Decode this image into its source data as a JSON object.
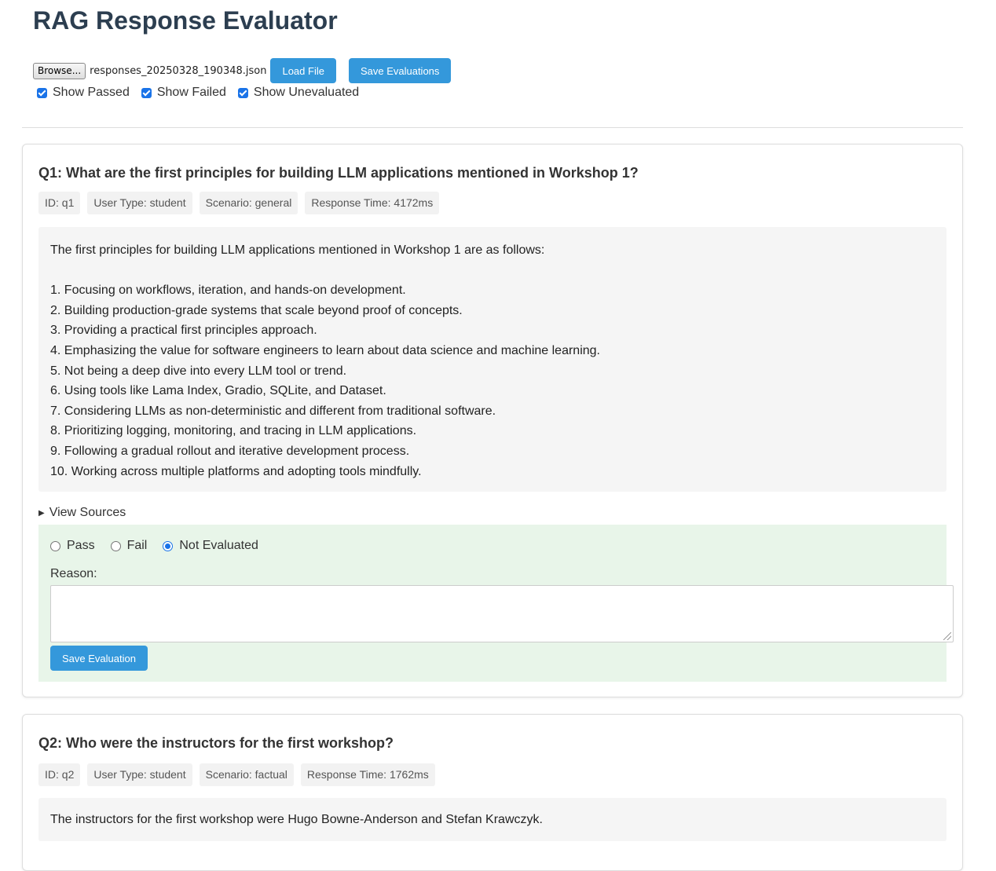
{
  "app": {
    "title": "RAG Response Evaluator"
  },
  "file": {
    "browse_label": "Browse...",
    "file_name": "responses_20250328_190348.json"
  },
  "toolbar": {
    "load_label": "Load File",
    "save_all_label": "Save Evaluations"
  },
  "filters": [
    {
      "label": "Show Passed",
      "checked": true
    },
    {
      "label": "Show Failed",
      "checked": true
    },
    {
      "label": "Show Unevaluated",
      "checked": true
    }
  ],
  "questions": [
    {
      "title": "Q1: What are the first principles for building LLM applications mentioned in Workshop 1?",
      "meta": [
        "ID: q1",
        "User Type: student",
        "Scenario: general",
        "Response Time: 4172ms"
      ],
      "answer_intro": "The first principles for building LLM applications mentioned in Workshop 1 are as follows:",
      "answer_items": [
        "1. Focusing on workflows, iteration, and hands-on development.",
        "2. Building production-grade systems that scale beyond proof of concepts.",
        "3. Providing a practical first principles approach.",
        "4. Emphasizing the value for software engineers to learn about data science and machine learning.",
        "5. Not being a deep dive into every LLM tool or trend.",
        "6. Using tools like Lama Index, Gradio, SQLite, and Dataset.",
        "7. Considering LLMs as non-deterministic and different from traditional software.",
        "8. Prioritizing logging, monitoring, and tracing in LLM applications.",
        "9. Following a gradual rollout and iterative development process.",
        "10. Working across multiple platforms and adopting tools mindfully."
      ],
      "sources_label": "View Sources",
      "evaluation": {
        "options": [
          "Pass",
          "Fail",
          "Not Evaluated"
        ],
        "selected": "Not Evaluated",
        "reason_label": "Reason:",
        "reason_value": "",
        "save_label": "Save Evaluation"
      }
    },
    {
      "title": "Q2: Who were the instructors for the first workshop?",
      "meta": [
        "ID: q2",
        "User Type: student",
        "Scenario: factual",
        "Response Time: 1762ms"
      ],
      "answer": "The instructors for the first workshop were Hugo Bowne-Anderson and Stefan Krawczyk."
    }
  ],
  "colors": {
    "accent": "#3498db",
    "title": "#2c3e50",
    "eval_bg": "#e8f5e9",
    "answer_bg": "#f5f5f5"
  }
}
